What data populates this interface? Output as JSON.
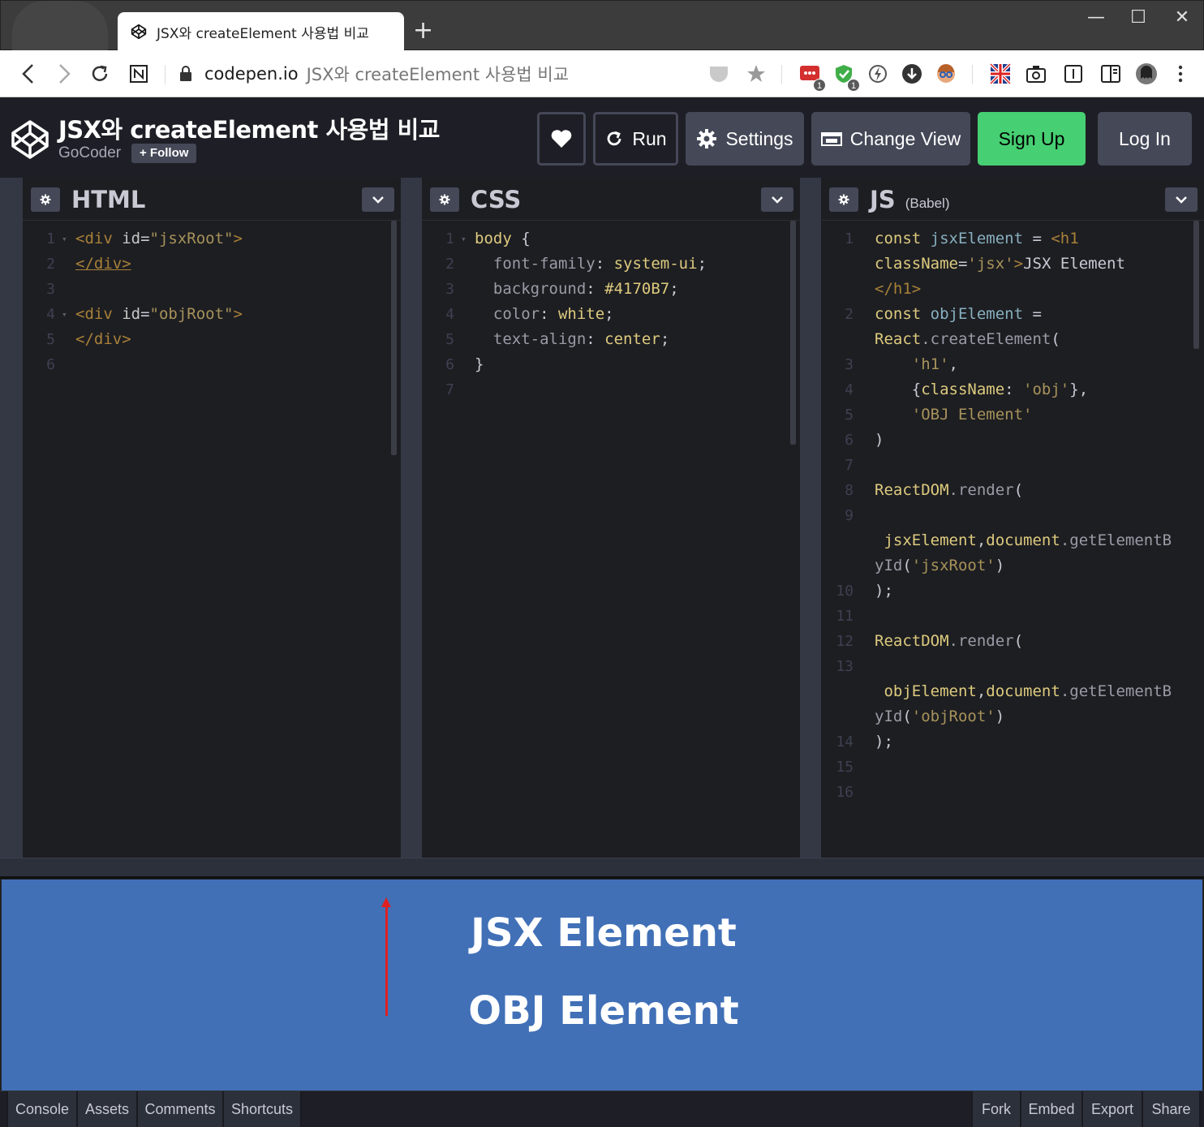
{
  "browser": {
    "tab_title": "JSX와 createElement 사용법 비교",
    "new_tab": "+",
    "address_host": "codepen.io",
    "address_title": "JSX와 createElement 사용법 비교",
    "ext_badge_1": "1",
    "ext_badge_2": "1"
  },
  "header": {
    "title": "JSX와 createElement 사용법 비교",
    "author": "GoCoder",
    "follow": "+ Follow",
    "run": "Run",
    "settings": "Settings",
    "change_view": "Change View",
    "sign_up": "Sign Up",
    "log_in": "Log In"
  },
  "editors": {
    "html": {
      "title": "HTML",
      "lines": [
        {
          "n": "1",
          "fold": true,
          "parts": [
            [
              "tag",
              "<div "
            ],
            [
              "attr",
              "id"
            ],
            [
              "plain",
              "="
            ],
            [
              "str",
              "\"jsxRoot\""
            ],
            [
              "tag",
              ">"
            ]
          ]
        },
        {
          "n": "2",
          "parts": [
            [
              "tag ul",
              "</div>"
            ]
          ]
        },
        {
          "n": "3",
          "parts": []
        },
        {
          "n": "4",
          "fold": true,
          "parts": [
            [
              "tag",
              "<div "
            ],
            [
              "attr",
              "id"
            ],
            [
              "plain",
              "="
            ],
            [
              "str",
              "\"objRoot\""
            ],
            [
              "tag",
              ">"
            ]
          ]
        },
        {
          "n": "5",
          "parts": [
            [
              "tag",
              "</div>"
            ]
          ]
        },
        {
          "n": "6",
          "parts": []
        }
      ]
    },
    "css": {
      "title": "CSS",
      "lines": [
        {
          "n": "1",
          "fold": true,
          "parts": [
            [
              "kw",
              "body"
            ],
            [
              "plain",
              " {"
            ]
          ]
        },
        {
          "n": "2",
          "parts": [
            [
              "prop",
              "  font-family"
            ],
            [
              "plain",
              ": "
            ],
            [
              "val",
              "system-ui"
            ],
            [
              "plain",
              ";"
            ]
          ]
        },
        {
          "n": "3",
          "parts": [
            [
              "prop",
              "  background"
            ],
            [
              "plain",
              ": "
            ],
            [
              "val",
              "#4170B7"
            ],
            [
              "plain",
              ";"
            ]
          ]
        },
        {
          "n": "4",
          "parts": [
            [
              "prop",
              "  color"
            ],
            [
              "plain",
              ": "
            ],
            [
              "val",
              "white"
            ],
            [
              "plain",
              ";"
            ]
          ]
        },
        {
          "n": "5",
          "parts": [
            [
              "prop",
              "  text-align"
            ],
            [
              "plain",
              ": "
            ],
            [
              "val",
              "center"
            ],
            [
              "plain",
              ";"
            ]
          ]
        },
        {
          "n": "6",
          "parts": [
            [
              "plain",
              "}"
            ]
          ]
        },
        {
          "n": "7",
          "parts": []
        }
      ]
    },
    "js": {
      "title": "JS",
      "subtitle": "(Babel)",
      "lines": [
        {
          "n": "1",
          "parts": [
            [
              "kw",
              "const "
            ],
            [
              "var",
              "jsxElement"
            ],
            [
              "plain",
              " = "
            ],
            [
              "tag",
              "<h1"
            ]
          ]
        },
        {
          "n": "",
          "parts": [
            [
              "kw",
              "className"
            ],
            [
              "plain",
              "="
            ],
            [
              "str",
              "'jsx'"
            ],
            [
              "tag",
              ">"
            ],
            [
              "plain",
              "JSX Element"
            ]
          ]
        },
        {
          "n": "",
          "parts": [
            [
              "tag",
              "</h1>"
            ]
          ]
        },
        {
          "n": "2",
          "parts": [
            [
              "kw",
              "const "
            ],
            [
              "var",
              "objElement"
            ],
            [
              "plain",
              " ="
            ]
          ]
        },
        {
          "n": "",
          "parts": [
            [
              "kw",
              "React"
            ],
            [
              "prop",
              ".createElement"
            ],
            [
              "plain",
              "("
            ]
          ]
        },
        {
          "n": "3",
          "parts": [
            [
              "str",
              "    'h1'"
            ],
            [
              "plain",
              ","
            ]
          ]
        },
        {
          "n": "4",
          "parts": [
            [
              "plain",
              "    {"
            ],
            [
              "kw",
              "className"
            ],
            [
              "plain",
              ": "
            ],
            [
              "str",
              "'obj'"
            ],
            [
              "plain",
              "},"
            ]
          ]
        },
        {
          "n": "5",
          "parts": [
            [
              "str",
              "    'OBJ Element'"
            ]
          ]
        },
        {
          "n": "6",
          "parts": [
            [
              "plain",
              ")"
            ]
          ]
        },
        {
          "n": "7",
          "parts": []
        },
        {
          "n": "8",
          "parts": [
            [
              "kw",
              "ReactDOM"
            ],
            [
              "prop",
              ".render"
            ],
            [
              "plain",
              "("
            ]
          ]
        },
        {
          "n": "9",
          "parts": []
        },
        {
          "n": "",
          "parts": [
            [
              "kw",
              " jsxElement"
            ],
            [
              "plain",
              ","
            ],
            [
              "kw",
              "document"
            ],
            [
              "prop",
              ".getElementB"
            ]
          ]
        },
        {
          "n": "",
          "parts": [
            [
              "prop",
              "yId"
            ],
            [
              "plain",
              "("
            ],
            [
              "str",
              "'jsxRoot'"
            ],
            [
              "plain",
              ")"
            ]
          ]
        },
        {
          "n": "10",
          "parts": [
            [
              "plain",
              ");"
            ]
          ]
        },
        {
          "n": "11",
          "parts": []
        },
        {
          "n": "12",
          "parts": [
            [
              "kw",
              "ReactDOM"
            ],
            [
              "prop",
              ".render"
            ],
            [
              "plain",
              "("
            ]
          ]
        },
        {
          "n": "13",
          "parts": []
        },
        {
          "n": "",
          "parts": [
            [
              "kw",
              " objElement"
            ],
            [
              "plain",
              ","
            ],
            [
              "kw",
              "document"
            ],
            [
              "prop",
              ".getElementB"
            ]
          ]
        },
        {
          "n": "",
          "parts": [
            [
              "prop",
              "yId"
            ],
            [
              "plain",
              "("
            ],
            [
              "str",
              "'objRoot'"
            ],
            [
              "plain",
              ")"
            ]
          ]
        },
        {
          "n": "14",
          "parts": [
            [
              "plain",
              ");"
            ]
          ]
        },
        {
          "n": "15",
          "parts": []
        },
        {
          "n": "16",
          "parts": []
        }
      ]
    }
  },
  "preview": {
    "heading_1": "JSX Element",
    "heading_2": "OBJ Element",
    "background": "#4170B7"
  },
  "footer": {
    "left": [
      "Console",
      "Assets",
      "Comments",
      "Shortcuts"
    ],
    "right": [
      "Fork",
      "Embed",
      "Export",
      "Share"
    ]
  }
}
